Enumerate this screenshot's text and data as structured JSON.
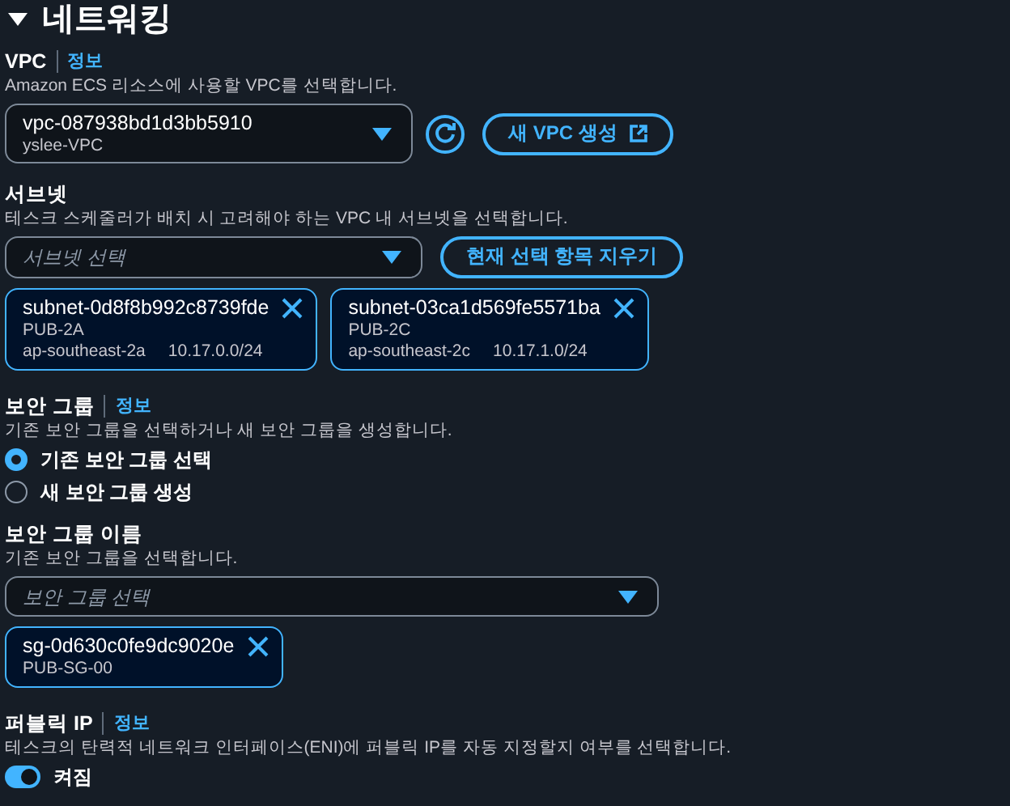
{
  "section": {
    "title": "네트워킹",
    "expanded": true
  },
  "vpc": {
    "label": "VPC",
    "info": "정보",
    "description": "Amazon ECS 리소스에 사용할 VPC를 선택합니다.",
    "value": "vpc-087938bd1d3bb5910",
    "subtitle": "yslee-VPC",
    "create_button": "새 VPC 생성"
  },
  "subnets": {
    "label": "서브넷",
    "description": "테스크 스케줄러가 배치 시 고려해야 하는 VPC 내 서브넷을 선택합니다.",
    "placeholder": "서브넷 선택",
    "clear_button": "현재 선택 항목 지우기",
    "tokens": [
      {
        "id": "subnet-0d8f8b992c8739fde",
        "name": "PUB-2A",
        "zone": "ap-southeast-2a",
        "cidr": "10.17.0.0/24"
      },
      {
        "id": "subnet-03ca1d569fe5571ba",
        "name": "PUB-2C",
        "zone": "ap-southeast-2c",
        "cidr": "10.17.1.0/24"
      }
    ]
  },
  "security_group": {
    "label": "보안 그룹",
    "info": "정보",
    "description": "기존 보안 그룹을 선택하거나 새 보안 그룹을 생성합니다.",
    "options": [
      {
        "label": "기존 보안 그룹 선택",
        "selected": true
      },
      {
        "label": "새 보안 그룹 생성",
        "selected": false
      }
    ]
  },
  "security_group_name": {
    "label": "보안 그룹 이름",
    "description": "기존 보안 그룹을 선택합니다.",
    "placeholder": "보안 그룹 선택",
    "tokens": [
      {
        "id": "sg-0d630c0fe9dc9020e",
        "name": "PUB-SG-00"
      }
    ]
  },
  "public_ip": {
    "label": "퍼블릭 IP",
    "info": "정보",
    "description": "테스크의 탄력적 네트워크 인터페이스(ENI)에 퍼블릭 IP를 자동 지정할지 여부를 선택합니다.",
    "toggle_label": "켜짐",
    "on": true
  }
}
